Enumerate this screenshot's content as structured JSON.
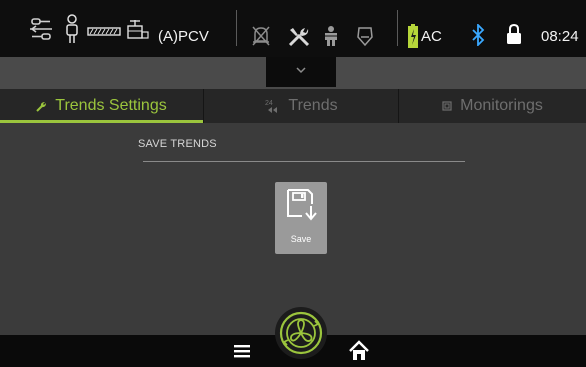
{
  "status": {
    "mode": "(A)PCV",
    "power": "AC",
    "time": "08:24"
  },
  "tabs": [
    {
      "label": "Trends Settings",
      "icon": "wrench-icon",
      "active": true
    },
    {
      "label": "Trends",
      "icon": "24h-rewind-icon",
      "active": false
    },
    {
      "label": "Monitorings",
      "icon": "square-icon",
      "active": false
    }
  ],
  "section": {
    "title": "SAVE TRENDS"
  },
  "save_button": {
    "label": "Save",
    "icon": "floppy-download-icon"
  },
  "colors": {
    "accent": "#9bc53d",
    "bluetooth": "#3aa8ff",
    "battery": "#b6d63a"
  },
  "bottom": {
    "menu_icon": "hamburger-icon",
    "fan_icon": "fan-icon",
    "home_icon": "home-icon"
  }
}
